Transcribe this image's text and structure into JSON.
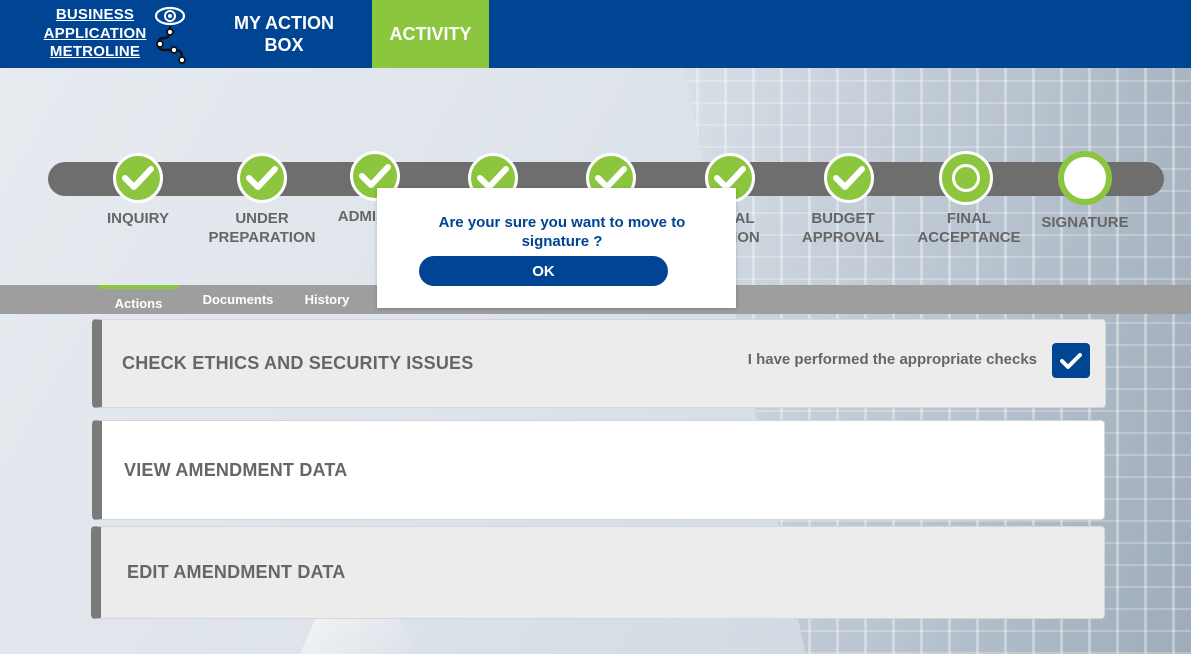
{
  "header": {
    "logo_text_1": "BUSINESS",
    "logo_text_2": "APPLICATION",
    "logo_text_3": "METROLINE",
    "nav_action_box_1": "MY ACTION",
    "nav_action_box_2": "BOX",
    "nav_activity": "ACTIVITY"
  },
  "colors": {
    "brand_blue": "#004494",
    "accent_green": "#8cc63e",
    "track_gray": "#6e6e6e",
    "label_gray": "#666666"
  },
  "steps": [
    {
      "line1": "INQUIRY",
      "line2": "",
      "status": "done"
    },
    {
      "line1": "UNDER",
      "line2": "PREPARATION",
      "status": "done"
    },
    {
      "line1": "ADMISSI",
      "line2": "",
      "status": "done"
    },
    {
      "line1": "",
      "line2": "",
      "status": "done"
    },
    {
      "line1": "",
      "line2": "",
      "status": "done"
    },
    {
      "line1": "CIAL",
      "line2": "ATION",
      "status": "done"
    },
    {
      "line1": "BUDGET",
      "line2": "APPROVAL",
      "status": "done"
    },
    {
      "line1": "FINAL",
      "line2": "ACCEPTANCE",
      "status": "current"
    },
    {
      "line1": "SIGNATURE",
      "line2": "",
      "status": "pending"
    }
  ],
  "tabs": {
    "actions": "Actions",
    "documents": "Documents",
    "history": "History"
  },
  "cards": {
    "ethics_title": "CHECK ETHICS AND SECURITY ISSUES",
    "ethics_check_label": "I have performed the appropriate checks",
    "ethics_checked": true,
    "view_title": "VIEW AMENDMENT DATA",
    "edit_title": "EDIT AMENDMENT DATA"
  },
  "modal": {
    "message": "Are your sure you want to move to signature ?",
    "ok_label": "OK"
  }
}
